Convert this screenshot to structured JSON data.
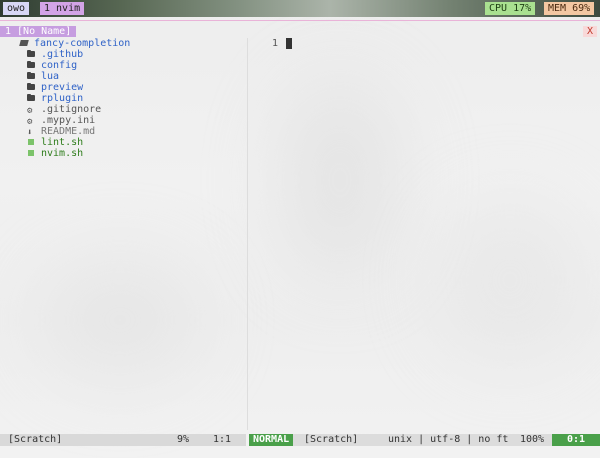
{
  "tmux": {
    "session": "owo",
    "window": "1 nvim",
    "cpu": "CPU 17%",
    "mem": "MEM 69%"
  },
  "tabline": {
    "active_tab": "1 [No Name]",
    "close": "X"
  },
  "tree": {
    "root": "fancy-completion",
    "items": [
      {
        "name": ".github",
        "type": "dir"
      },
      {
        "name": "config",
        "type": "dir"
      },
      {
        "name": "lua",
        "type": "dir"
      },
      {
        "name": "preview",
        "type": "dir"
      },
      {
        "name": "rplugin",
        "type": "dir"
      },
      {
        "name": ".gitignore",
        "type": "config"
      },
      {
        "name": ".mypy.ini",
        "type": "config"
      },
      {
        "name": "README.md",
        "type": "readme"
      },
      {
        "name": "lint.sh",
        "type": "script"
      },
      {
        "name": "nvim.sh",
        "type": "script"
      }
    ]
  },
  "editor": {
    "line_number": "1"
  },
  "status_left": {
    "name": "[Scratch]",
    "percent": "9%",
    "position": "1:1"
  },
  "status_right": {
    "mode": "NORMAL",
    "name": "[Scratch]",
    "info": "unix | utf-8 | no ft",
    "percent": "100%",
    "position": "0:1"
  },
  "colors": {
    "mode_green": "#4aa04a",
    "tab_purple": "#c69de0",
    "dir_blue": "#2f62c7",
    "script_green": "#2f7d1c"
  }
}
